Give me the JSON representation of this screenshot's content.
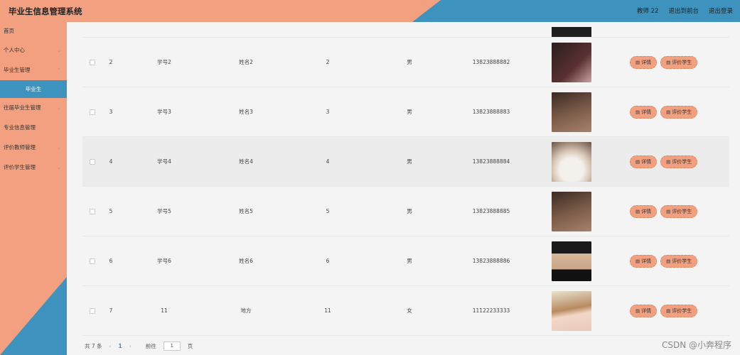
{
  "header": {
    "title": "毕业生信息管理系统",
    "user": "教师 22",
    "front_link": "退出到前台",
    "logout_link": "退出登录"
  },
  "sidebar": {
    "items": [
      {
        "label": "首页",
        "chevron": false
      },
      {
        "label": "个人中心",
        "chevron": true
      },
      {
        "label": "毕业生管理",
        "chevron": true
      },
      {
        "label": "毕业生",
        "chevron": false,
        "active": true
      },
      {
        "label": "往届毕业生管理",
        "chevron": true
      },
      {
        "label": "专业信息管理",
        "chevron": false
      },
      {
        "label": "评价教师管理",
        "chevron": true
      },
      {
        "label": "评价学生管理",
        "chevron": true
      }
    ]
  },
  "table": {
    "rows": [
      {
        "idx": "2",
        "xuehao": "学号2",
        "name": "姓名2",
        "num": "2",
        "gender": "男",
        "phone": "13823888882",
        "photo": "person-dark"
      },
      {
        "idx": "3",
        "xuehao": "学号3",
        "name": "姓名3",
        "num": "3",
        "gender": "男",
        "phone": "13823888883",
        "photo": "person-brown"
      },
      {
        "idx": "4",
        "xuehao": "学号4",
        "name": "姓名4",
        "num": "4",
        "gender": "男",
        "phone": "13823888884",
        "photo": "cat"
      },
      {
        "idx": "5",
        "xuehao": "学号5",
        "name": "姓名5",
        "num": "5",
        "gender": "男",
        "phone": "13823888885",
        "photo": "person-brown"
      },
      {
        "idx": "6",
        "xuehao": "学号6",
        "name": "姓名6",
        "num": "6",
        "gender": "男",
        "phone": "13823888886",
        "photo": "person-cap"
      },
      {
        "idx": "7",
        "xuehao": "11",
        "name": "地方",
        "num": "11",
        "gender": "女",
        "phone": "11122233333",
        "photo": "person-girl"
      }
    ],
    "detail_label": "详情",
    "evaluate_label": "评价学生"
  },
  "pager": {
    "total": "共 7 条",
    "current": "1",
    "goto_label": "前往",
    "goto_value": "1",
    "page_suffix": "页"
  },
  "watermark": "CSDN @小奔程序",
  "colors": {
    "accent": "#f2a07f",
    "blue": "#3d93bd"
  }
}
